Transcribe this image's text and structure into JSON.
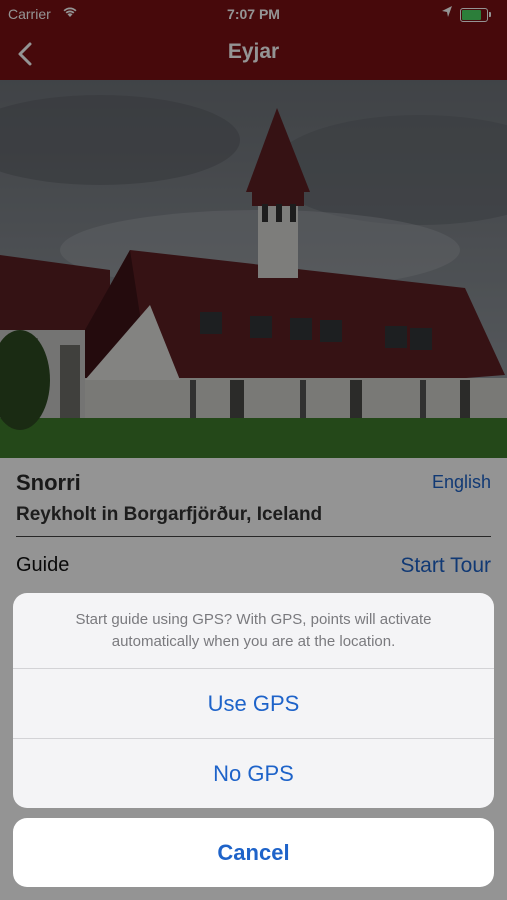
{
  "status_bar": {
    "carrier": "Carrier",
    "time": "7:07 PM",
    "battery_level": 0.85,
    "icons": [
      "wifi-icon",
      "location-arrow-icon",
      "battery-icon"
    ]
  },
  "nav": {
    "title": "Eyjar",
    "back_icon": "chevron-left-icon"
  },
  "hero": {
    "description_icon": "church-photo"
  },
  "place": {
    "name": "Snorri",
    "language": "English",
    "location": "Reykholt in Borgarfjörður, Iceland",
    "guide_label": "Guide",
    "start_tour": "Start Tour"
  },
  "action_sheet": {
    "message": "Start guide using GPS? With GPS, points will activate automatically when you are at the location.",
    "use_gps": "Use GPS",
    "no_gps": "No GPS",
    "cancel": "Cancel"
  },
  "colors": {
    "nav_background": "#7a1114",
    "link_blue": "#1e63c9",
    "battery_green": "#4cd964"
  }
}
